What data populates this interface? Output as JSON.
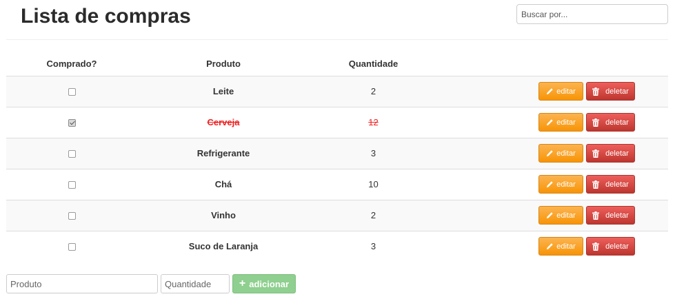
{
  "page": {
    "title": "Lista de compras"
  },
  "search": {
    "placeholder": "Buscar por..."
  },
  "table": {
    "headers": {
      "check": "Comprado?",
      "product": "Produto",
      "quantity": "Quantidade"
    },
    "rows": [
      {
        "product": "Leite",
        "quantity": "2",
        "bought": false
      },
      {
        "product": "Cerveja",
        "quantity": "12",
        "bought": true
      },
      {
        "product": "Refrigerante",
        "quantity": "3",
        "bought": false
      },
      {
        "product": "Chá",
        "quantity": "10",
        "bought": false
      },
      {
        "product": "Vinho",
        "quantity": "2",
        "bought": false
      },
      {
        "product": "Suco de Laranja",
        "quantity": "3",
        "bought": false
      }
    ],
    "edit_label": "editar",
    "delete_label": "deletar"
  },
  "add_form": {
    "product_placeholder": "Produto",
    "quantity_placeholder": "Quantidade",
    "add_label": "adicionar"
  },
  "colors": {
    "edit": "#f89406",
    "delete": "#bd362f",
    "add": "#8fcf8f",
    "done_text": "#ee2222"
  },
  "icons": {
    "edit": "pencil-icon",
    "delete": "trash-icon",
    "add": "plus-icon"
  }
}
